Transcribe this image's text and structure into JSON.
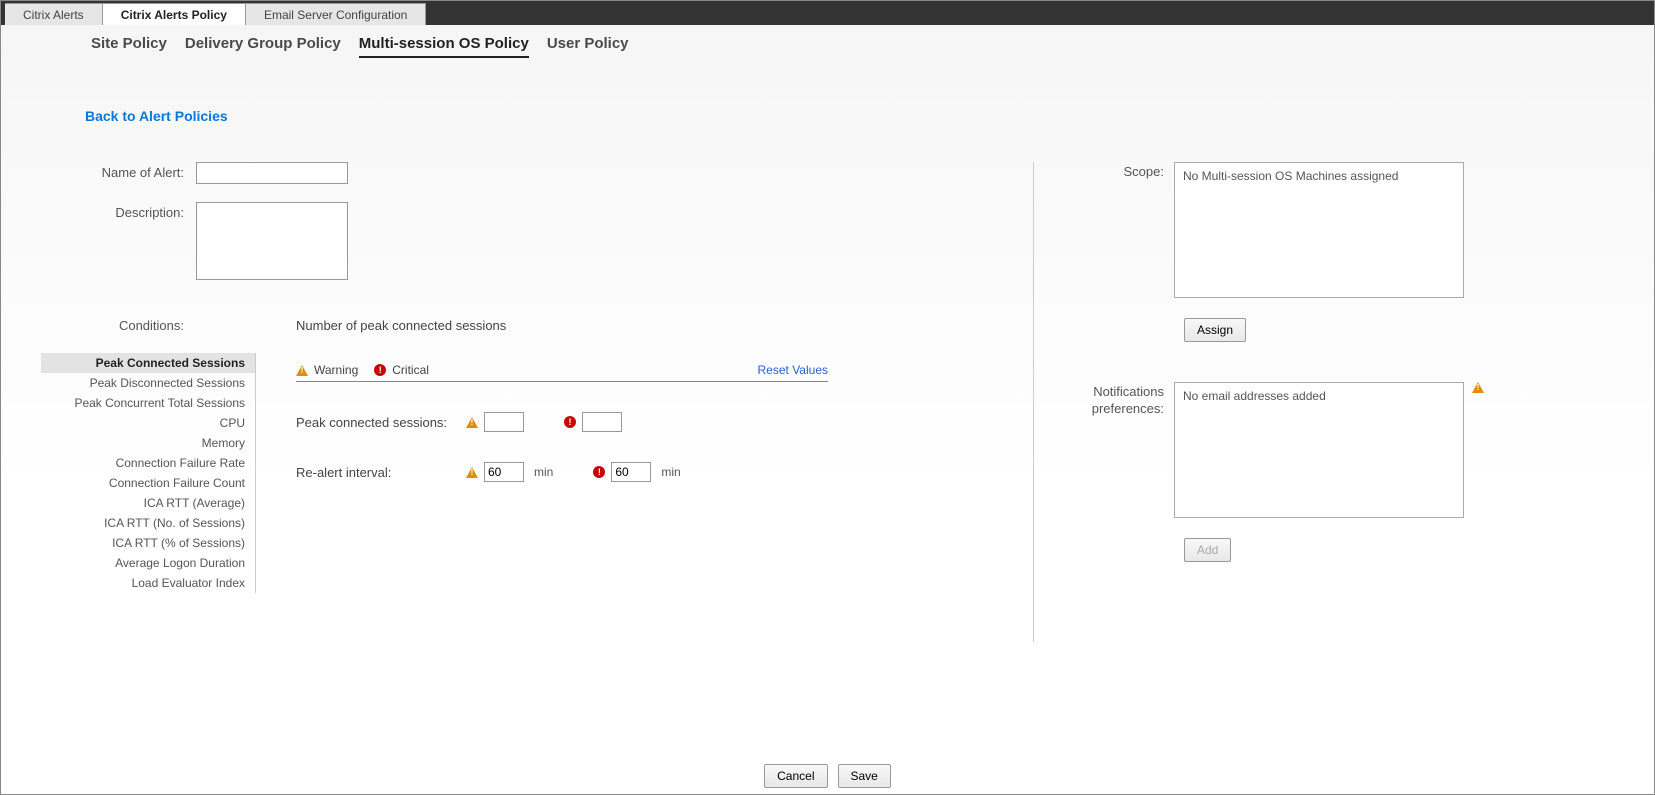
{
  "top_tabs": {
    "alerts": "Citrix Alerts",
    "policy": "Citrix Alerts Policy",
    "email_config": "Email Server Configuration"
  },
  "subnav": {
    "site": "Site Policy",
    "delivery": "Delivery Group Policy",
    "multisession": "Multi-session OS Policy",
    "user": "User Policy"
  },
  "back_link": "Back to Alert Policies",
  "labels": {
    "name_of_alert": "Name of Alert:",
    "description": "Description:",
    "conditions": "Conditions:",
    "scope": "Scope:",
    "notif_prefs_line1": "Notifications",
    "notif_prefs_line2": "preferences:"
  },
  "form": {
    "name_value": "",
    "description_value": ""
  },
  "conditions": [
    "Peak Connected Sessions",
    "Peak Disconnected Sessions",
    "Peak Concurrent Total Sessions",
    "CPU",
    "Memory",
    "Connection Failure Rate",
    "Connection Failure Count",
    "ICA RTT (Average)",
    "ICA RTT (No. of Sessions)",
    "ICA RTT (% of Sessions)",
    "Average Logon Duration",
    "Load Evaluator Index"
  ],
  "detail": {
    "title": "Number of peak connected sessions",
    "legend_warning": "Warning",
    "legend_critical": "Critical",
    "reset_values": "Reset Values",
    "param_peak_label": "Peak connected sessions:",
    "param_realert_label": "Re-alert interval:",
    "peak_warning_value": "",
    "peak_critical_value": "",
    "realert_warning_value": "60",
    "realert_critical_value": "60",
    "unit_min": "min"
  },
  "scope": {
    "box_text": "No Multi-session OS Machines assigned",
    "assign_btn": "Assign"
  },
  "notif": {
    "box_text": "No email addresses added",
    "add_btn": "Add"
  },
  "footer": {
    "cancel": "Cancel",
    "save": "Save"
  }
}
